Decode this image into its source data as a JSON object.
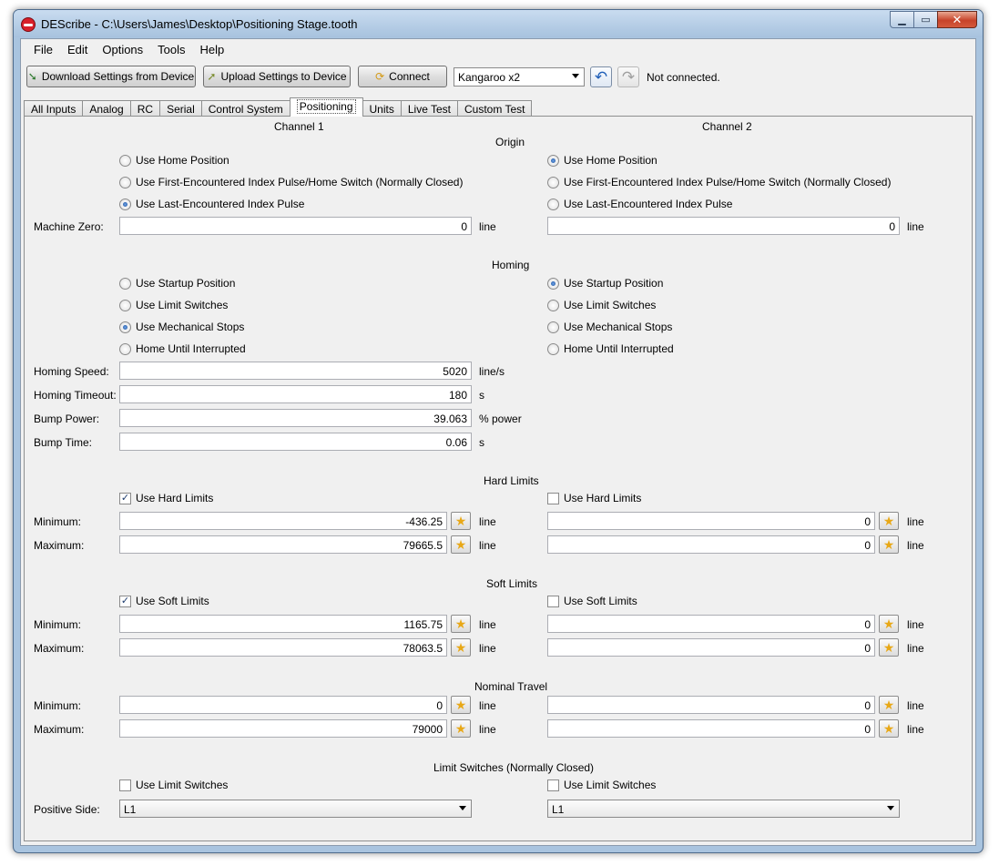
{
  "window": {
    "title": "DEScribe - C:\\Users\\James\\Desktop\\Positioning Stage.tooth"
  },
  "menu": {
    "file": "File",
    "edit": "Edit",
    "options": "Options",
    "tools": "Tools",
    "help": "Help"
  },
  "toolbar": {
    "download": "Download Settings from Device",
    "upload": "Upload Settings to Device",
    "connect": "Connect",
    "device": "Kangaroo x2",
    "status": "Not connected."
  },
  "tabs": [
    "All Inputs",
    "Analog",
    "RC",
    "Serial",
    "Control System",
    "Positioning",
    "Units",
    "Live Test",
    "Custom Test"
  ],
  "columns": {
    "ch1": "Channel 1",
    "ch2": "Channel 2"
  },
  "origin": {
    "title": "Origin",
    "options": [
      "Use Home Position",
      "Use First-Encountered Index Pulse/Home Switch (Normally Closed)",
      "Use Last-Encountered Index Pulse"
    ],
    "ch1_selected": 2,
    "ch2_selected": 0,
    "machine_zero_label": "Machine Zero:",
    "ch1_machine_zero": "0",
    "ch2_machine_zero": "0",
    "unit": "line"
  },
  "homing": {
    "title": "Homing",
    "options": [
      "Use Startup Position",
      "Use Limit Switches",
      "Use Mechanical Stops",
      "Home Until Interrupted"
    ],
    "ch1_selected": 2,
    "ch2_selected": 0,
    "speed_label": "Homing Speed:",
    "speed": "5020",
    "speed_unit": "line/s",
    "timeout_label": "Homing Timeout:",
    "timeout": "180",
    "timeout_unit": "s",
    "bump_power_label": "Bump Power:",
    "bump_power": "39.063",
    "bump_power_unit": "% power",
    "bump_time_label": "Bump Time:",
    "bump_time": "0.06",
    "bump_time_unit": "s"
  },
  "hard_limits": {
    "title": "Hard Limits",
    "use_label": "Use Hard Limits",
    "ch1_checked": true,
    "ch2_checked": false,
    "min_label": "Minimum:",
    "max_label": "Maximum:",
    "ch1_min": "-436.25",
    "ch1_max": "79665.5",
    "ch2_min": "0",
    "ch2_max": "0",
    "unit": "line"
  },
  "soft_limits": {
    "title": "Soft Limits",
    "use_label": "Use Soft Limits",
    "ch1_checked": true,
    "ch2_checked": false,
    "min_label": "Minimum:",
    "max_label": "Maximum:",
    "ch1_min": "1165.75",
    "ch1_max": "78063.5",
    "ch2_min": "0",
    "ch2_max": "0",
    "unit": "line"
  },
  "nominal_travel": {
    "title": "Nominal Travel",
    "min_label": "Minimum:",
    "max_label": "Maximum:",
    "ch1_min": "0",
    "ch1_max": "79000",
    "ch2_min": "0",
    "ch2_max": "0",
    "unit": "line"
  },
  "limit_switches": {
    "title": "Limit Switches (Normally Closed)",
    "use_label": "Use Limit Switches",
    "ch1_checked": false,
    "ch2_checked": false,
    "positive_side_label": "Positive Side:",
    "ch1_positive_side": "L1",
    "ch2_positive_side": "L1"
  }
}
